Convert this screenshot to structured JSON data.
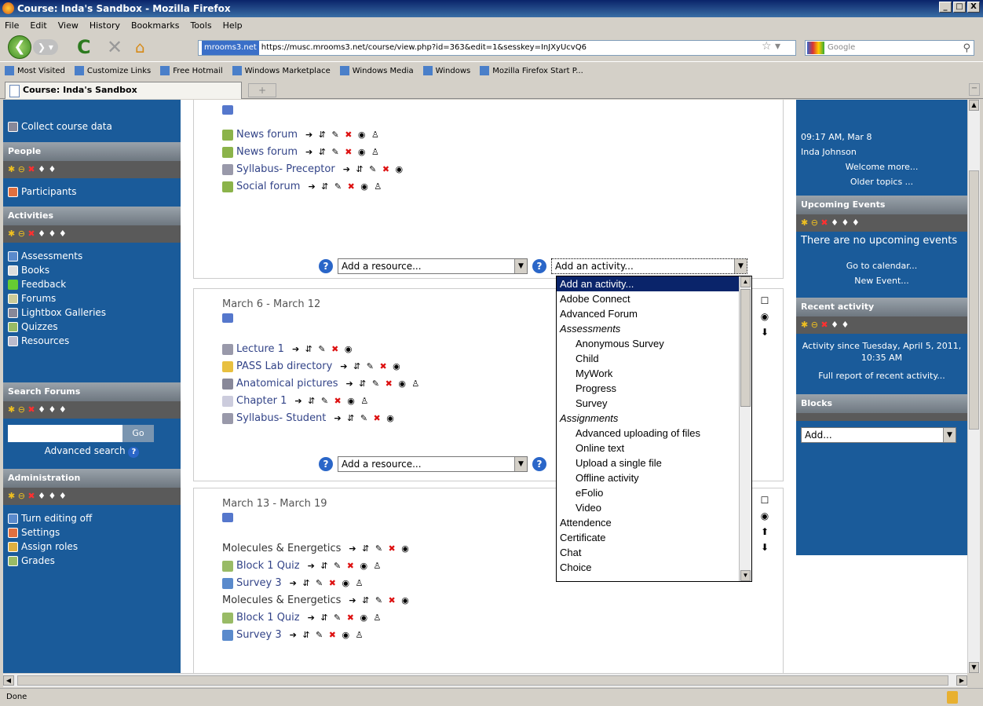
{
  "window": {
    "title": "Course: Inda's Sandbox - Mozilla Firefox",
    "min": "_",
    "max": "□",
    "close": "X"
  },
  "menu": [
    "File",
    "Edit",
    "View",
    "History",
    "Bookmarks",
    "Tools",
    "Help"
  ],
  "nav": {
    "url_identity": "mrooms3.net",
    "url": "https://musc.mrooms3.net/course/view.php?id=363&edit=1&sesskey=InJXyUcvQ6",
    "search_placeholder": "Google"
  },
  "bookmarks": [
    "Most Visited",
    "Customize Links",
    "Free Hotmail",
    "Windows Marketplace",
    "Windows Media",
    "Windows",
    "Mozilla Firefox Start P..."
  ],
  "tab": {
    "label": "Course: Inda's Sandbox",
    "new": "+"
  },
  "left": {
    "collect": "Collect course data",
    "people_header": "People",
    "participants": "Participants",
    "activities_header": "Activities",
    "activities": [
      "Assessments",
      "Books",
      "Feedback",
      "Forums",
      "Lightbox Galleries",
      "Quizzes",
      "Resources"
    ],
    "search_header": "Search Forums",
    "go": "Go",
    "advanced_search": "Advanced search",
    "admin_header": "Administration",
    "admin": [
      "Turn editing off",
      "Settings",
      "Assign roles",
      "Grades"
    ]
  },
  "main": {
    "section0": {
      "items": [
        "News forum",
        "News forum",
        "Syllabus- Preceptor",
        "Social forum"
      ]
    },
    "add_resource": "Add a resource...",
    "add_activity": "Add an activity...",
    "section1": {
      "title": "March 6 - March 12",
      "items": [
        "Lecture 1",
        "PASS Lab directory",
        "Anatomical pictures",
        "Chapter 1",
        "Syllabus- Student"
      ]
    },
    "section2": {
      "title": "March 13 - March 19",
      "items": [
        "Molecules & Energetics",
        "Block 1 Quiz",
        "Survey 3",
        "Molecules & Energetics",
        "Block 1 Quiz",
        "Survey 3"
      ]
    }
  },
  "dropdown": {
    "options": [
      {
        "label": "Add an activity...",
        "kind": "sel"
      },
      {
        "label": "Adobe Connect",
        "kind": ""
      },
      {
        "label": "Advanced Forum",
        "kind": ""
      },
      {
        "label": "Assessments",
        "kind": "grp"
      },
      {
        "label": "Anonymous Survey",
        "kind": "sub"
      },
      {
        "label": "Child",
        "kind": "sub"
      },
      {
        "label": "MyWork",
        "kind": "sub"
      },
      {
        "label": "Progress",
        "kind": "sub"
      },
      {
        "label": "Survey",
        "kind": "sub"
      },
      {
        "label": "Assignments",
        "kind": "grp"
      },
      {
        "label": "Advanced uploading of files",
        "kind": "sub"
      },
      {
        "label": "Online text",
        "kind": "sub"
      },
      {
        "label": "Upload a single file",
        "kind": "sub"
      },
      {
        "label": "Offline activity",
        "kind": "sub"
      },
      {
        "label": "eFolio",
        "kind": "sub"
      },
      {
        "label": "Video",
        "kind": "sub"
      },
      {
        "label": "Attendence",
        "kind": ""
      },
      {
        "label": "Certificate",
        "kind": ""
      },
      {
        "label": "Chat",
        "kind": ""
      },
      {
        "label": "Choice",
        "kind": ""
      }
    ]
  },
  "right": {
    "time": "09:17 AM, Mar 8",
    "user": "Inda Johnson",
    "welcome": "Welcome more...",
    "older": "Older topics ...",
    "upcoming_header": "Upcoming Events",
    "no_events": "There are no upcoming events",
    "go_calendar": "Go to calendar...",
    "new_event": "New Event...",
    "recent_header": "Recent activity",
    "since": "Activity since Tuesday, April 5, 2011, 10:35 AM",
    "full_report": "Full report of recent activity...",
    "blocks_header": "Blocks",
    "blocks_add": "Add..."
  },
  "status": "Done"
}
